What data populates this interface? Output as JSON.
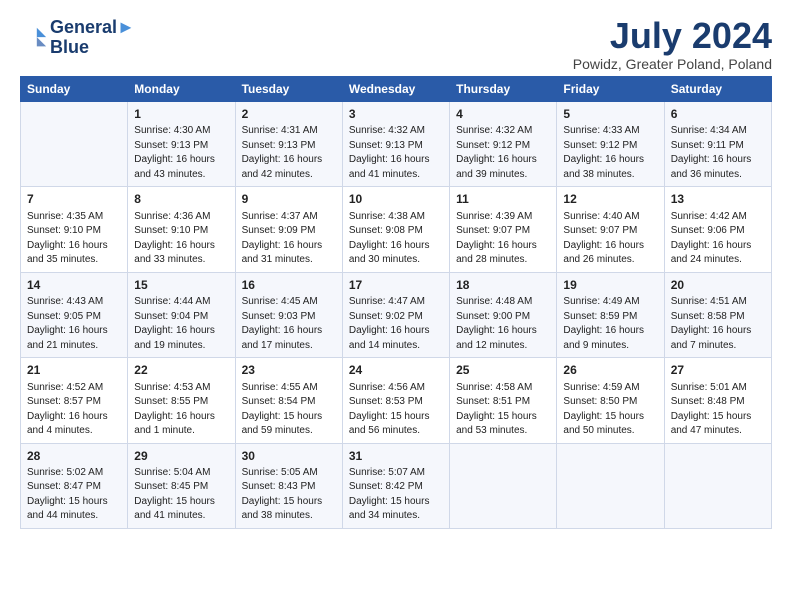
{
  "logo": {
    "line1": "General",
    "line2": "Blue"
  },
  "title": "July 2024",
  "subtitle": "Powidz, Greater Poland, Poland",
  "days_header": [
    "Sunday",
    "Monday",
    "Tuesday",
    "Wednesday",
    "Thursday",
    "Friday",
    "Saturday"
  ],
  "weeks": [
    [
      {
        "day": "",
        "lines": []
      },
      {
        "day": "1",
        "lines": [
          "Sunrise: 4:30 AM",
          "Sunset: 9:13 PM",
          "Daylight: 16 hours",
          "and 43 minutes."
        ]
      },
      {
        "day": "2",
        "lines": [
          "Sunrise: 4:31 AM",
          "Sunset: 9:13 PM",
          "Daylight: 16 hours",
          "and 42 minutes."
        ]
      },
      {
        "day": "3",
        "lines": [
          "Sunrise: 4:32 AM",
          "Sunset: 9:13 PM",
          "Daylight: 16 hours",
          "and 41 minutes."
        ]
      },
      {
        "day": "4",
        "lines": [
          "Sunrise: 4:32 AM",
          "Sunset: 9:12 PM",
          "Daylight: 16 hours",
          "and 39 minutes."
        ]
      },
      {
        "day": "5",
        "lines": [
          "Sunrise: 4:33 AM",
          "Sunset: 9:12 PM",
          "Daylight: 16 hours",
          "and 38 minutes."
        ]
      },
      {
        "day": "6",
        "lines": [
          "Sunrise: 4:34 AM",
          "Sunset: 9:11 PM",
          "Daylight: 16 hours",
          "and 36 minutes."
        ]
      }
    ],
    [
      {
        "day": "7",
        "lines": [
          "Sunrise: 4:35 AM",
          "Sunset: 9:10 PM",
          "Daylight: 16 hours",
          "and 35 minutes."
        ]
      },
      {
        "day": "8",
        "lines": [
          "Sunrise: 4:36 AM",
          "Sunset: 9:10 PM",
          "Daylight: 16 hours",
          "and 33 minutes."
        ]
      },
      {
        "day": "9",
        "lines": [
          "Sunrise: 4:37 AM",
          "Sunset: 9:09 PM",
          "Daylight: 16 hours",
          "and 31 minutes."
        ]
      },
      {
        "day": "10",
        "lines": [
          "Sunrise: 4:38 AM",
          "Sunset: 9:08 PM",
          "Daylight: 16 hours",
          "and 30 minutes."
        ]
      },
      {
        "day": "11",
        "lines": [
          "Sunrise: 4:39 AM",
          "Sunset: 9:07 PM",
          "Daylight: 16 hours",
          "and 28 minutes."
        ]
      },
      {
        "day": "12",
        "lines": [
          "Sunrise: 4:40 AM",
          "Sunset: 9:07 PM",
          "Daylight: 16 hours",
          "and 26 minutes."
        ]
      },
      {
        "day": "13",
        "lines": [
          "Sunrise: 4:42 AM",
          "Sunset: 9:06 PM",
          "Daylight: 16 hours",
          "and 24 minutes."
        ]
      }
    ],
    [
      {
        "day": "14",
        "lines": [
          "Sunrise: 4:43 AM",
          "Sunset: 9:05 PM",
          "Daylight: 16 hours",
          "and 21 minutes."
        ]
      },
      {
        "day": "15",
        "lines": [
          "Sunrise: 4:44 AM",
          "Sunset: 9:04 PM",
          "Daylight: 16 hours",
          "and 19 minutes."
        ]
      },
      {
        "day": "16",
        "lines": [
          "Sunrise: 4:45 AM",
          "Sunset: 9:03 PM",
          "Daylight: 16 hours",
          "and 17 minutes."
        ]
      },
      {
        "day": "17",
        "lines": [
          "Sunrise: 4:47 AM",
          "Sunset: 9:02 PM",
          "Daylight: 16 hours",
          "and 14 minutes."
        ]
      },
      {
        "day": "18",
        "lines": [
          "Sunrise: 4:48 AM",
          "Sunset: 9:00 PM",
          "Daylight: 16 hours",
          "and 12 minutes."
        ]
      },
      {
        "day": "19",
        "lines": [
          "Sunrise: 4:49 AM",
          "Sunset: 8:59 PM",
          "Daylight: 16 hours",
          "and 9 minutes."
        ]
      },
      {
        "day": "20",
        "lines": [
          "Sunrise: 4:51 AM",
          "Sunset: 8:58 PM",
          "Daylight: 16 hours",
          "and 7 minutes."
        ]
      }
    ],
    [
      {
        "day": "21",
        "lines": [
          "Sunrise: 4:52 AM",
          "Sunset: 8:57 PM",
          "Daylight: 16 hours",
          "and 4 minutes."
        ]
      },
      {
        "day": "22",
        "lines": [
          "Sunrise: 4:53 AM",
          "Sunset: 8:55 PM",
          "Daylight: 16 hours",
          "and 1 minute."
        ]
      },
      {
        "day": "23",
        "lines": [
          "Sunrise: 4:55 AM",
          "Sunset: 8:54 PM",
          "Daylight: 15 hours",
          "and 59 minutes."
        ]
      },
      {
        "day": "24",
        "lines": [
          "Sunrise: 4:56 AM",
          "Sunset: 8:53 PM",
          "Daylight: 15 hours",
          "and 56 minutes."
        ]
      },
      {
        "day": "25",
        "lines": [
          "Sunrise: 4:58 AM",
          "Sunset: 8:51 PM",
          "Daylight: 15 hours",
          "and 53 minutes."
        ]
      },
      {
        "day": "26",
        "lines": [
          "Sunrise: 4:59 AM",
          "Sunset: 8:50 PM",
          "Daylight: 15 hours",
          "and 50 minutes."
        ]
      },
      {
        "day": "27",
        "lines": [
          "Sunrise: 5:01 AM",
          "Sunset: 8:48 PM",
          "Daylight: 15 hours",
          "and 47 minutes."
        ]
      }
    ],
    [
      {
        "day": "28",
        "lines": [
          "Sunrise: 5:02 AM",
          "Sunset: 8:47 PM",
          "Daylight: 15 hours",
          "and 44 minutes."
        ]
      },
      {
        "day": "29",
        "lines": [
          "Sunrise: 5:04 AM",
          "Sunset: 8:45 PM",
          "Daylight: 15 hours",
          "and 41 minutes."
        ]
      },
      {
        "day": "30",
        "lines": [
          "Sunrise: 5:05 AM",
          "Sunset: 8:43 PM",
          "Daylight: 15 hours",
          "and 38 minutes."
        ]
      },
      {
        "day": "31",
        "lines": [
          "Sunrise: 5:07 AM",
          "Sunset: 8:42 PM",
          "Daylight: 15 hours",
          "and 34 minutes."
        ]
      },
      {
        "day": "",
        "lines": []
      },
      {
        "day": "",
        "lines": []
      },
      {
        "day": "",
        "lines": []
      }
    ]
  ]
}
